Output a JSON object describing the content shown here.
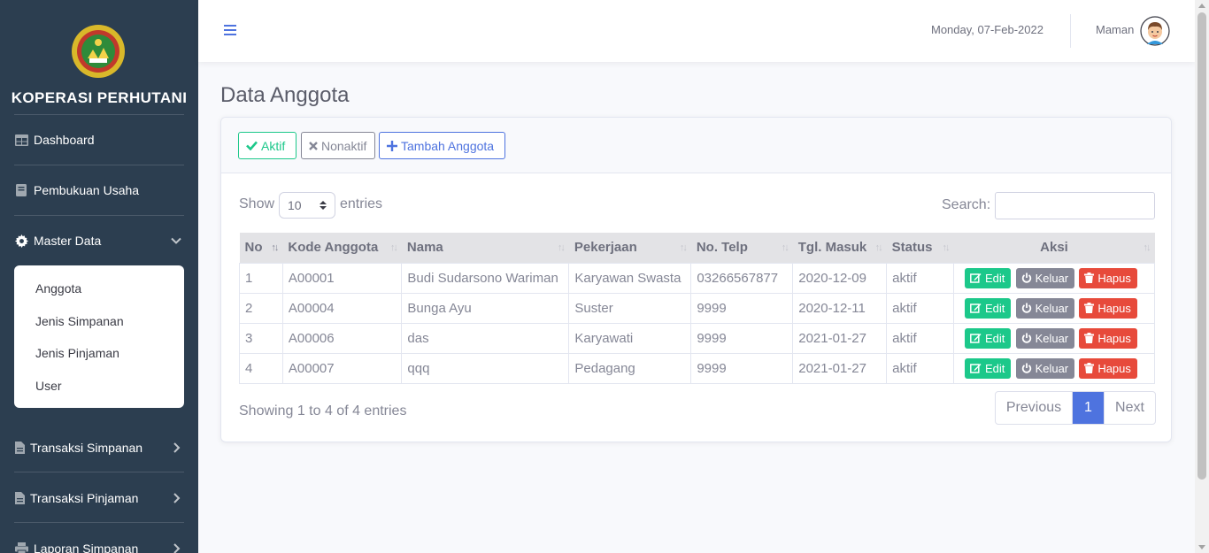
{
  "sidebar": {
    "brand": "KOPERASI PERHUTANI",
    "items": [
      {
        "label": "Dashboard",
        "icon": "table-icon"
      },
      {
        "label": "Pembukuan Usaha",
        "icon": "book-icon"
      },
      {
        "label": "Master Data",
        "icon": "gear-icon"
      },
      {
        "label": "Transaksi Simpanan",
        "icon": "file-icon"
      },
      {
        "label": "Transaksi Pinjaman",
        "icon": "file-icon"
      },
      {
        "label": "Laporan Simpanan",
        "icon": "print-icon"
      }
    ],
    "submenu": [
      "Anggota",
      "Jenis Simpanan",
      "Jenis Pinjaman",
      "User"
    ]
  },
  "topbar": {
    "date": "Monday, 07-Feb-2022",
    "user": "Maman"
  },
  "main": {
    "title": "Data Anggota",
    "buttons": {
      "aktif": "Aktif",
      "nonaktif": "Nonaktif",
      "tambah": "Tambah Anggota"
    },
    "show": "Show",
    "length": "10",
    "entries": "entries",
    "search_label": "Search:",
    "search_value": "",
    "columns": [
      "No",
      "Kode Anggota",
      "Nama",
      "Pekerjaan",
      "No. Telp",
      "Tgl. Masuk",
      "Status",
      "Aksi"
    ],
    "rows": [
      [
        "1",
        "A00001",
        "Budi Sudarsono Wariman",
        "Karyawan Swasta",
        "03266567877",
        "2020-12-09",
        "aktif"
      ],
      [
        "2",
        "A00004",
        "Bunga Ayu",
        "Suster",
        "9999",
        "2020-12-11",
        "aktif"
      ],
      [
        "3",
        "A00006",
        "das",
        "Karyawati",
        "9999",
        "2021-01-27",
        "aktif"
      ],
      [
        "4",
        "A00007",
        "qqq",
        "Pedagang",
        "9999",
        "2021-01-27",
        "aktif"
      ]
    ],
    "actions": {
      "edit": "Edit",
      "keluar": "Keluar",
      "hapus": "Hapus"
    },
    "info": "Showing 1 to 4 of 4 entries",
    "pagination": {
      "previous": "Previous",
      "current": "1",
      "next": "Next"
    }
  },
  "colors": {
    "sidebar_bg": "#2c3e50",
    "primary": "#4e73df",
    "success": "#1cc88a",
    "secondary": "#858796",
    "danger": "#e74a3b"
  }
}
